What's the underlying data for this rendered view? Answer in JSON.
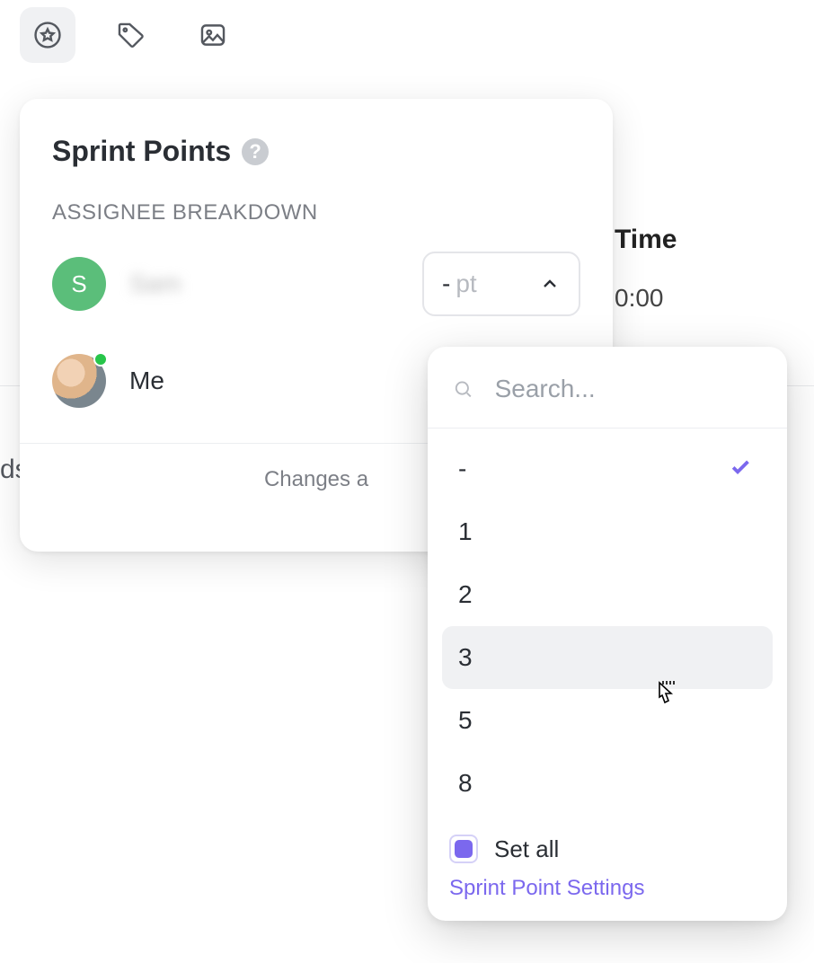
{
  "toolbar": {
    "star_icon": "star-badge",
    "tag_icon": "tag",
    "image_icon": "image"
  },
  "background": {
    "time_label": "Time",
    "time_value": "0:00",
    "truncated_text": "ds"
  },
  "card": {
    "title": "Sprint Points",
    "help": "?",
    "section_label": "ASSIGNEE BREAKDOWN",
    "assignees": [
      {
        "initial": "S",
        "name": "Sam",
        "name_blurred": true,
        "points_value": "-",
        "points_unit": "pt",
        "selector_open": true
      },
      {
        "initial": "",
        "name": "Me",
        "name_blurred": false,
        "has_photo": true,
        "presence": true
      }
    ],
    "footer_text": "Changes a"
  },
  "dropdown": {
    "search_placeholder": "Search...",
    "options": [
      {
        "label": "-",
        "selected": true
      },
      {
        "label": "1"
      },
      {
        "label": "2"
      },
      {
        "label": "3",
        "hovered": true
      },
      {
        "label": "5"
      },
      {
        "label": "8"
      }
    ],
    "set_all_label": "Set all",
    "set_all_checked": true,
    "settings_link": "Sprint Point Settings"
  }
}
